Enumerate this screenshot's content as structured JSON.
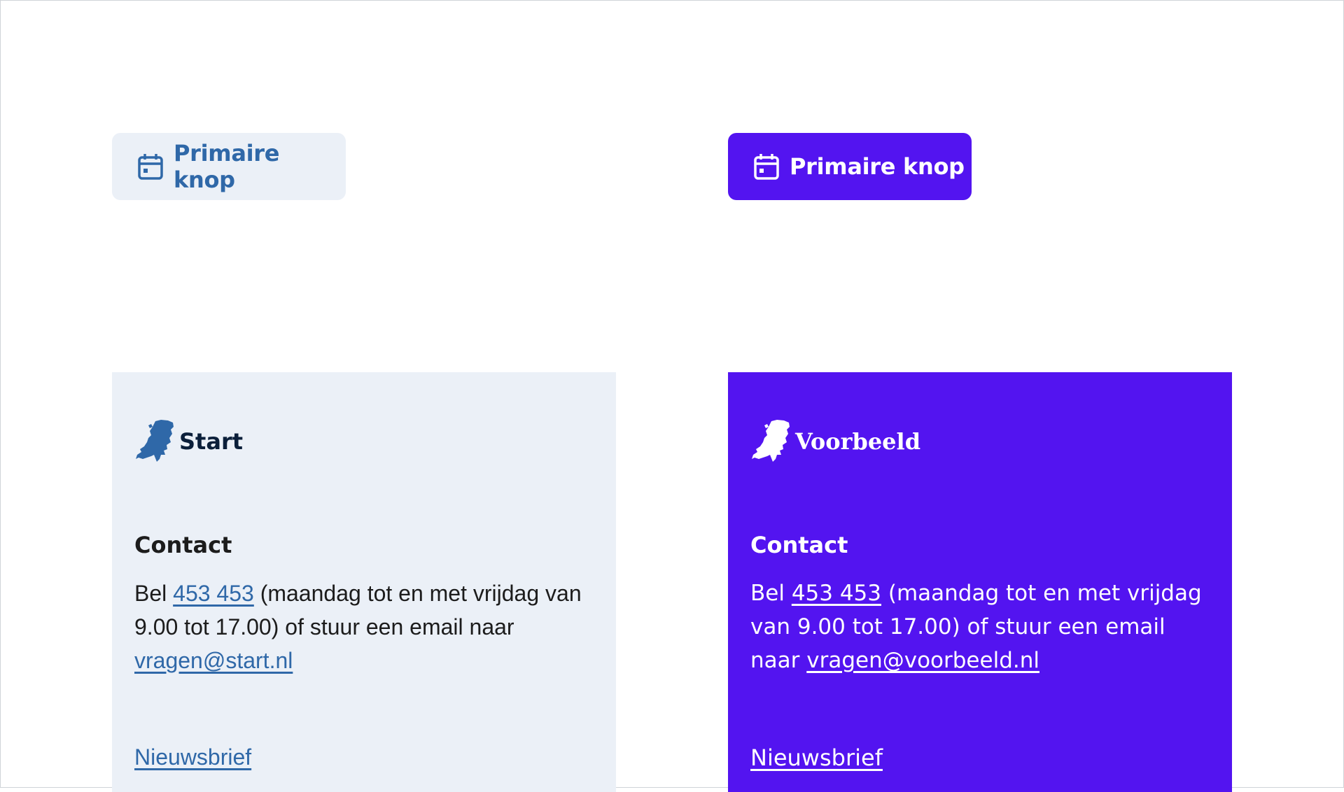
{
  "buttons": {
    "start": {
      "label": "Primaire knop",
      "icon": "calendar-icon",
      "background": "#ebf0f7",
      "color": "#2f68a8"
    },
    "voorbeeld": {
      "label": "Primaire knop",
      "icon": "calendar-icon",
      "background": "#5314f0",
      "color": "#ffffff"
    }
  },
  "footers": {
    "start": {
      "logo_text": "Start",
      "logo_icon": "netherlands-map-icon",
      "contact_title": "Contact",
      "text_bel": "Bel ",
      "phone": "453 453",
      "text_middle": " (maandag tot en met vrijdag van 9.00 tot 17.00) of stuur een email naar ",
      "email": "vragen@start.nl",
      "newsletter": "Nieuwsbrief",
      "background": "#ebf0f7"
    },
    "voorbeeld": {
      "logo_text": "Voorbeeld",
      "logo_icon": "netherlands-map-icon",
      "contact_title": "Contact",
      "text_bel": "Bel ",
      "phone": "453 453",
      "text_middle": " (maandag tot en met vrijdag van 9.00 tot 17.00) of stuur een email naar ",
      "email": "vragen@voorbeeld.nl",
      "newsletter": "Nieuwsbrief",
      "background": "#5314f0"
    }
  }
}
